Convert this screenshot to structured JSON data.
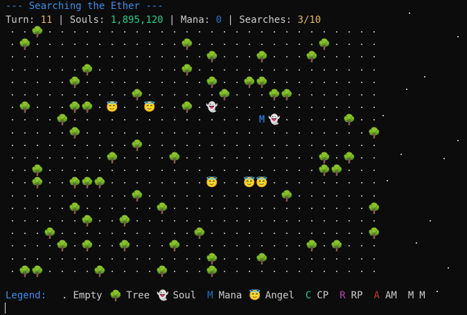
{
  "header": {
    "title": "--- Searching the Ether ---",
    "turn_label": "Turn: ",
    "turn_value": "11",
    "souls_label": "Souls: ",
    "souls_value": "1,895,120",
    "mana_label": "Mana: ",
    "mana_value": "0",
    "searches_label": "Searches: ",
    "searches_value": "3/10",
    "separator": " | "
  },
  "legend": {
    "title": "Legend:",
    "empty_symbol": ".",
    "empty_label": "Empty",
    "tree_label": "Tree",
    "soul_label": "Soul",
    "mana_symbol": "M",
    "mana_label": "Mana",
    "angel_label": "Angel",
    "cp_symbol": "C",
    "cp_label": "CP",
    "rp_symbol": "R",
    "rp_label": "RP",
    "am_symbol": "A",
    "am_label": "AM",
    "mm_symbol": "M",
    "mm_label": "M"
  },
  "map": {
    "columns": 30,
    "rows": 20,
    "entities": [
      {
        "type": "tree",
        "col": 2,
        "row": 0
      },
      {
        "type": "tree",
        "col": 1,
        "row": 1
      },
      {
        "type": "tree",
        "col": 14,
        "row": 1
      },
      {
        "type": "tree",
        "col": 25,
        "row": 1
      },
      {
        "type": "tree",
        "col": 16,
        "row": 2
      },
      {
        "type": "tree",
        "col": 20,
        "row": 2
      },
      {
        "type": "tree",
        "col": 24,
        "row": 2
      },
      {
        "type": "tree",
        "col": 6,
        "row": 3
      },
      {
        "type": "tree",
        "col": 14,
        "row": 3
      },
      {
        "type": "tree",
        "col": 5,
        "row": 4
      },
      {
        "type": "tree",
        "col": 16,
        "row": 4
      },
      {
        "type": "tree",
        "col": 19,
        "row": 4
      },
      {
        "type": "tree",
        "col": 20,
        "row": 4
      },
      {
        "type": "tree",
        "col": 10,
        "row": 5
      },
      {
        "type": "tree",
        "col": 17,
        "row": 5
      },
      {
        "type": "tree",
        "col": 21,
        "row": 5
      },
      {
        "type": "tree",
        "col": 22,
        "row": 5
      },
      {
        "type": "tree",
        "col": 1,
        "row": 6
      },
      {
        "type": "tree",
        "col": 5,
        "row": 6
      },
      {
        "type": "tree",
        "col": 6,
        "row": 6
      },
      {
        "type": "angel",
        "col": 8,
        "row": 6
      },
      {
        "type": "angel",
        "col": 11,
        "row": 6
      },
      {
        "type": "tree",
        "col": 14,
        "row": 6
      },
      {
        "type": "soul",
        "col": 16,
        "row": 6
      },
      {
        "type": "tree",
        "col": 4,
        "row": 7
      },
      {
        "type": "mana",
        "col": 20,
        "row": 7
      },
      {
        "type": "soul",
        "col": 21,
        "row": 7
      },
      {
        "type": "tree",
        "col": 27,
        "row": 7
      },
      {
        "type": "tree",
        "col": 5,
        "row": 8
      },
      {
        "type": "tree",
        "col": 29,
        "row": 8
      },
      {
        "type": "tree",
        "col": 10,
        "row": 9
      },
      {
        "type": "tree",
        "col": 8,
        "row": 10
      },
      {
        "type": "tree",
        "col": 13,
        "row": 10
      },
      {
        "type": "tree",
        "col": 25,
        "row": 10
      },
      {
        "type": "tree",
        "col": 27,
        "row": 10
      },
      {
        "type": "tree",
        "col": 2,
        "row": 11
      },
      {
        "type": "tree",
        "col": 25,
        "row": 11
      },
      {
        "type": "tree",
        "col": 26,
        "row": 11
      },
      {
        "type": "tree",
        "col": 2,
        "row": 12
      },
      {
        "type": "tree",
        "col": 5,
        "row": 12
      },
      {
        "type": "tree",
        "col": 6,
        "row": 12
      },
      {
        "type": "tree",
        "col": 7,
        "row": 12
      },
      {
        "type": "angel",
        "col": 16,
        "row": 12
      },
      {
        "type": "angel",
        "col": 19,
        "row": 12
      },
      {
        "type": "angel",
        "col": 20,
        "row": 12
      },
      {
        "type": "tree",
        "col": 10,
        "row": 13
      },
      {
        "type": "tree",
        "col": 22,
        "row": 13
      },
      {
        "type": "tree",
        "col": 5,
        "row": 14
      },
      {
        "type": "tree",
        "col": 12,
        "row": 14
      },
      {
        "type": "tree",
        "col": 29,
        "row": 14
      },
      {
        "type": "tree",
        "col": 6,
        "row": 15
      },
      {
        "type": "tree",
        "col": 9,
        "row": 15
      },
      {
        "type": "tree",
        "col": 3,
        "row": 16
      },
      {
        "type": "tree",
        "col": 15,
        "row": 16
      },
      {
        "type": "tree",
        "col": 29,
        "row": 16
      },
      {
        "type": "tree",
        "col": 4,
        "row": 17
      },
      {
        "type": "tree",
        "col": 6,
        "row": 17
      },
      {
        "type": "tree",
        "col": 9,
        "row": 17
      },
      {
        "type": "tree",
        "col": 13,
        "row": 17
      },
      {
        "type": "tree",
        "col": 24,
        "row": 17
      },
      {
        "type": "tree",
        "col": 26,
        "row": 17
      },
      {
        "type": "tree",
        "col": 16,
        "row": 18
      },
      {
        "type": "tree",
        "col": 20,
        "row": 18
      },
      {
        "type": "tree",
        "col": 1,
        "row": 19
      },
      {
        "type": "tree",
        "col": 2,
        "row": 19
      },
      {
        "type": "tree",
        "col": 7,
        "row": 19
      },
      {
        "type": "tree",
        "col": 12,
        "row": 19
      },
      {
        "type": "tree",
        "col": 16,
        "row": 19
      }
    ]
  },
  "glyphs": {
    "tree": "🌳",
    "soul": "👻",
    "angel": "😇",
    "mana": "M"
  },
  "colors": {
    "background": "#0c0c0c",
    "title": "#3b8eea",
    "tree": "#1f9a1f",
    "mana": "#2472c8",
    "angel": "#f4a93b",
    "cp": "#23d18b",
    "rp": "#bc3fbc",
    "am": "#cd3131"
  }
}
